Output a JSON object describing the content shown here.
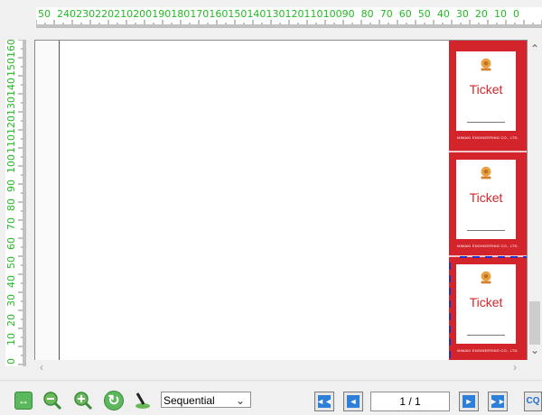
{
  "rulers": {
    "horizontal_labels": [
      "50",
      "240",
      "230",
      "220",
      "210",
      "200",
      "190",
      "180",
      "170",
      "160",
      "150",
      "140",
      "130",
      "120",
      "110",
      "100",
      "90",
      "80",
      "70",
      "60",
      "50",
      "40",
      "30",
      "20",
      "10",
      "0"
    ],
    "vertical_labels": [
      "160",
      "150",
      "140",
      "130",
      "120",
      "110",
      "100",
      "90",
      "80",
      "70",
      "60",
      "50",
      "40",
      "30",
      "20",
      "10",
      "0"
    ],
    "label_color": "#22bb22"
  },
  "tickets": [
    {
      "title": "Ticket",
      "footer": "MIMAKI ENGINEERING CO., LTD."
    },
    {
      "title": "Ticket",
      "footer": "MIMAKI ENGINEERING CO., LTD."
    },
    {
      "title": "Ticket",
      "footer": "MIMAKI ENGINEERING CO., LTD."
    }
  ],
  "colors": {
    "ticket_red": "#d4242b",
    "accent_blue": "#2e7fd8",
    "ruler_green": "#22bb22"
  },
  "toolbar": {
    "icons": [
      "fit-page-icon",
      "zoom-out-icon",
      "zoom-in-icon",
      "refresh-icon",
      "place-icon"
    ],
    "order_select": {
      "value": "Sequential"
    },
    "pagination": {
      "current": "1",
      "separator": "/",
      "total": "1",
      "display": "1 / 1"
    },
    "trailing_button_label": "CQ"
  }
}
